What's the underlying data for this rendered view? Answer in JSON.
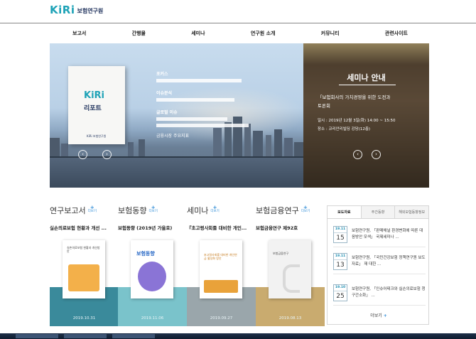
{
  "header": {
    "logo_mark": "KiRi",
    "logo_text": "보험연구원"
  },
  "nav": [
    "보고서",
    "간행물",
    "세미나",
    "연구원 소개",
    "커뮤니티",
    "관련사이트"
  ],
  "hero": {
    "cover_brand": "KiRi",
    "cover_title": "리포트",
    "cover_publisher": "KiRi 보험연구원",
    "section1": "포커스",
    "section2": "이슈분석",
    "section3": "글로벌 이슈",
    "footer": "금융시장 주요지표"
  },
  "seminar": {
    "title": "세미나 안내",
    "subtitle": "「보험회사의 가치경영을 위한 도전과",
    "subtitle2": "토론회",
    "time": "일시 : 2019년 12월 3일(화) 14:00 ~ 15:50",
    "place": "장소 : 코리안리빌딩 강당(12층)"
  },
  "sections": [
    {
      "title": "연구보고서",
      "more": "더보기",
      "desc": "실손의료보험 현황과 개선 ...",
      "date": "2019.10.31",
      "color": "#3a8a9b",
      "book_title": "실손의료보험 현황과 개선방안",
      "book_color": "#f1a33b"
    },
    {
      "title": "보험동향",
      "more": "더보기",
      "desc": "보험동향 (2019년 가을호)",
      "date": "2019.11.06",
      "color": "#7ac3cb",
      "book_title": "보험동향",
      "book_color": "#7b68c9"
    },
    {
      "title": "세미나",
      "more": "더보기",
      "desc": "『초고령사회를 대비한 개인...",
      "date": "2019.09.27",
      "color": "#9aa6ab",
      "book_title": "초고령사회를 대비한 개인연금 활성화 방안",
      "book_color": "#e9a23a"
    },
    {
      "title": "보험금융연구",
      "more": "더보기",
      "desc": "보험금융연구 제92호",
      "date": "2019.08.13",
      "color": "#c9ab6f",
      "book_title": "보험금융연구",
      "book_color": "#666666"
    }
  ],
  "news": {
    "tabs": [
      "보도자료",
      "주간동향",
      "해외보험동향정보"
    ],
    "items": [
      {
        "month": "19.11",
        "day": "15",
        "text": "보험연구원, 「판매채널 환경변화에 따른 대응방안 모색」 국제세미나 ..."
      },
      {
        "month": "19.11",
        "day": "13",
        "text": "보험연구원, 「국민건강보험 정책연구원 보도자료」 재 대한 ..."
      },
      {
        "month": "19.10",
        "day": "25",
        "text": "보험연구원, 「인슈어테크와 실손의료보험 청구간소화」 ..."
      }
    ],
    "more": "더보기"
  }
}
